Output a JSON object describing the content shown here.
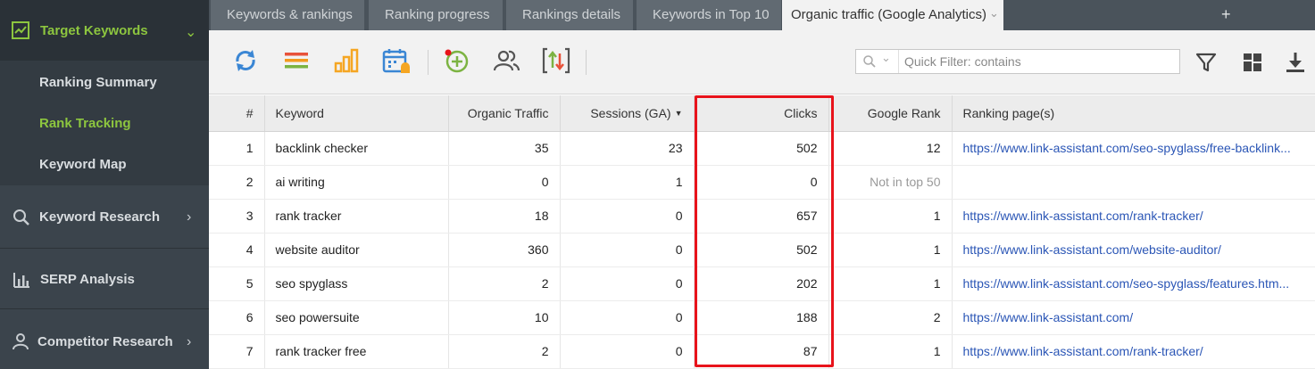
{
  "sidebar": {
    "active_section": "Target Keywords",
    "sub_items": [
      "Ranking Summary",
      "Rank Tracking",
      "Keyword Map"
    ],
    "active_sub_item": "Rank Tracking",
    "sections": [
      "Keyword Research",
      "SERP Analysis",
      "Competitor Research"
    ]
  },
  "tabs": [
    "Keywords & rankings",
    "Ranking progress",
    "Rankings details",
    "Keywords in Top 10",
    "Organic traffic (Google Analytics)"
  ],
  "active_tab": "Organic traffic (Google Analytics)",
  "toolbar": {
    "icons": [
      "refresh-icon",
      "list-icon",
      "bar-chart-icon",
      "calendar-icon",
      "add-keyword-icon",
      "users-icon",
      "import-export-icon"
    ],
    "search_placeholder": "Quick Filter: contains",
    "right_icons": [
      "filter-icon",
      "grid-layout-icon",
      "download-icon"
    ]
  },
  "table": {
    "columns": [
      "#",
      "Keyword",
      "Organic Traffic",
      "Sessions (GA)",
      "Clicks",
      "Google Rank",
      "Ranking page(s)"
    ],
    "sorted_column": "Sessions (GA)",
    "rows": [
      {
        "num": "1",
        "keyword": "backlink checker",
        "organic": "35",
        "sessions": "23",
        "clicks": "502",
        "rank": "12",
        "page": "https://www.link-assistant.com/seo-spyglass/free-backlink..."
      },
      {
        "num": "2",
        "keyword": "ai writing",
        "organic": "0",
        "sessions": "1",
        "clicks": "0",
        "rank": "Not in top 50",
        "page": ""
      },
      {
        "num": "3",
        "keyword": "rank tracker",
        "organic": "18",
        "sessions": "0",
        "clicks": "657",
        "rank": "1",
        "page": "https://www.link-assistant.com/rank-tracker/"
      },
      {
        "num": "4",
        "keyword": "website auditor",
        "organic": "360",
        "sessions": "0",
        "clicks": "502",
        "rank": "1",
        "page": "https://www.link-assistant.com/website-auditor/"
      },
      {
        "num": "5",
        "keyword": "seo spyglass",
        "organic": "2",
        "sessions": "0",
        "clicks": "202",
        "rank": "1",
        "page": "https://www.link-assistant.com/seo-spyglass/features.htm..."
      },
      {
        "num": "6",
        "keyword": "seo powersuite",
        "organic": "10",
        "sessions": "0",
        "clicks": "188",
        "rank": "2",
        "page": "https://www.link-assistant.com/"
      },
      {
        "num": "7",
        "keyword": "rank tracker free",
        "organic": "2",
        "sessions": "0",
        "clicks": "87",
        "rank": "1",
        "page": "https://www.link-assistant.com/rank-tracker/"
      }
    ]
  },
  "colors": {
    "accent_green": "#8dc63f",
    "highlight_red": "#e8131b",
    "link_blue": "#2b56b6"
  }
}
